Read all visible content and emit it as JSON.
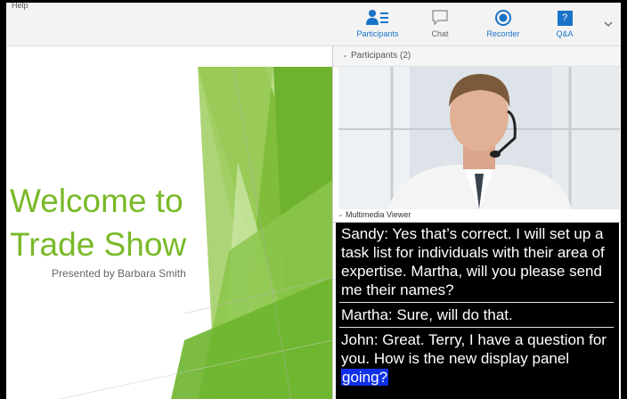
{
  "menu": {
    "help_label": "Help"
  },
  "toolbar": {
    "participants_label": "Participants",
    "chat_label": "Chat",
    "recorder_label": "Recorder",
    "qa_label": "Q&A",
    "qa_icon_glyph": "?",
    "accent_color": "#1a73c8"
  },
  "slide": {
    "title_line1": "Welcome to",
    "title_line2": "Trade Show",
    "subtitle": "Presented by Barbara Smith",
    "title_color": "#79b928"
  },
  "participants_panel": {
    "header": "Participants (2)"
  },
  "multimedia_panel": {
    "header": "Multimedia Viewer",
    "captions": [
      {
        "text": "Sandy: Yes that’s correct.  I will set up a task list for individuals with their area of expertise.  Martha, will you please send me their names?"
      },
      {
        "text": "Martha:  Sure, will do that."
      },
      {
        "text": "John:  Great.  Terry, I have a question for you.  How is the new display panel ",
        "highlight": "going?"
      }
    ]
  }
}
